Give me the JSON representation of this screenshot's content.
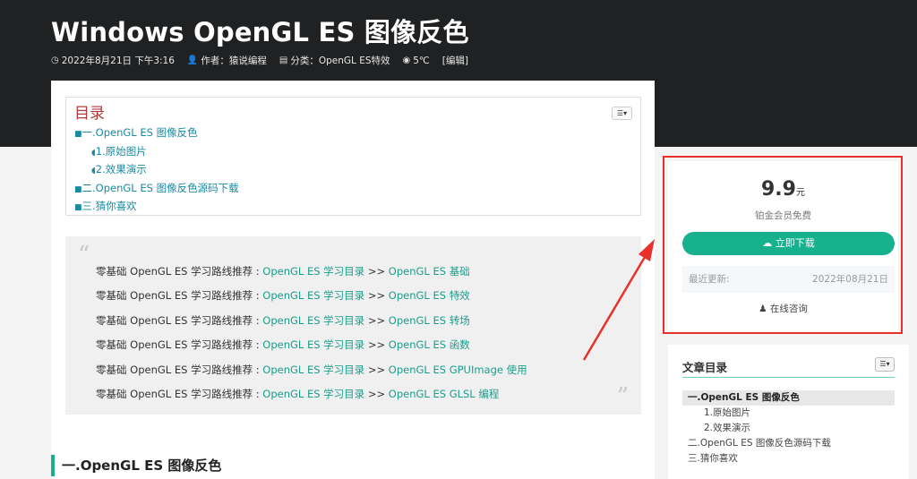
{
  "page": {
    "title": "Windows OpenGL ES 图像反色",
    "meta": {
      "date": "2022年8月21日 下午3:16",
      "author": "作者：猿说编程",
      "category": "分类：OpenGL ES特效",
      "views": "5℃",
      "edit": "[编辑]"
    }
  },
  "toc": {
    "title": "目录",
    "toggle_icon": "list-toggle",
    "items": [
      {
        "bullet": "■",
        "label": "一.OpenGL ES 图像反色"
      },
      {
        "bullet": "◖",
        "label": "1.原始图片"
      },
      {
        "bullet": "◖",
        "label": "2.效果演示"
      },
      {
        "bullet": "■",
        "label": "二.OpenGL ES 图像反色源码下载"
      },
      {
        "bullet": "■",
        "label": "三.猜你喜欢"
      }
    ]
  },
  "quote": {
    "open_mark": "“",
    "close_mark": "”",
    "lines": [
      {
        "prefix": "零基础 OpenGL ES 学习路线推荐 : ",
        "link1": "OpenGL ES 学习目录",
        "sep": " >> ",
        "link2": "OpenGL ES 基础"
      },
      {
        "prefix": "零基础 OpenGL ES 学习路线推荐 : ",
        "link1": "OpenGL ES 学习目录",
        "sep": "  >> ",
        "link2": "OpenGL ES 特效"
      },
      {
        "prefix": "零基础 OpenGL ES 学习路线推荐 : ",
        "link1": "OpenGL ES 学习目录",
        "sep": "  >> ",
        "link2": "OpenGL ES 转场"
      },
      {
        "prefix": "零基础 OpenGL ES 学习路线推荐 :  ",
        "link1": "OpenGL ES 学习目录",
        "sep": " >> ",
        "link2": "OpenGL ES 函数"
      },
      {
        "prefix": "零基础 OpenGL ES 学习路线推荐 :  ",
        "link1": "OpenGL ES 学习目录",
        "sep": " >> ",
        "link2": "OpenGL ES GPUImage 使用"
      },
      {
        "prefix": "零基础 OpenGL ES 学习路线推荐 :  ",
        "link1": "OpenGL ES 学习目录",
        "sep": " >> ",
        "link2": "OpenGL ES GLSL 编程"
      }
    ]
  },
  "section": {
    "heading": "一.OpenGL ES 图像反色"
  },
  "purchase": {
    "price": "9.9",
    "unit": "元",
    "member_note": "铂金会员免费",
    "download_label": "立即下载",
    "update_label": "最近更新:",
    "update_date": "2022年08月21日",
    "consult_label": "在线咨询",
    "highlight_color": "#e8302c",
    "accent_color": "#18b18e"
  },
  "side_toc": {
    "title": "文章目录",
    "items": [
      {
        "label": "一.OpenGL ES 图像反色",
        "level": 1,
        "active": true
      },
      {
        "label": "1.原始图片",
        "level": 2,
        "active": false
      },
      {
        "label": "2.效果演示",
        "level": 2,
        "active": false
      },
      {
        "label": "二.OpenGL ES 图像反色源码下载",
        "level": 1,
        "active": false
      },
      {
        "label": "三.猜你喜欢",
        "level": 1,
        "active": false
      }
    ]
  }
}
